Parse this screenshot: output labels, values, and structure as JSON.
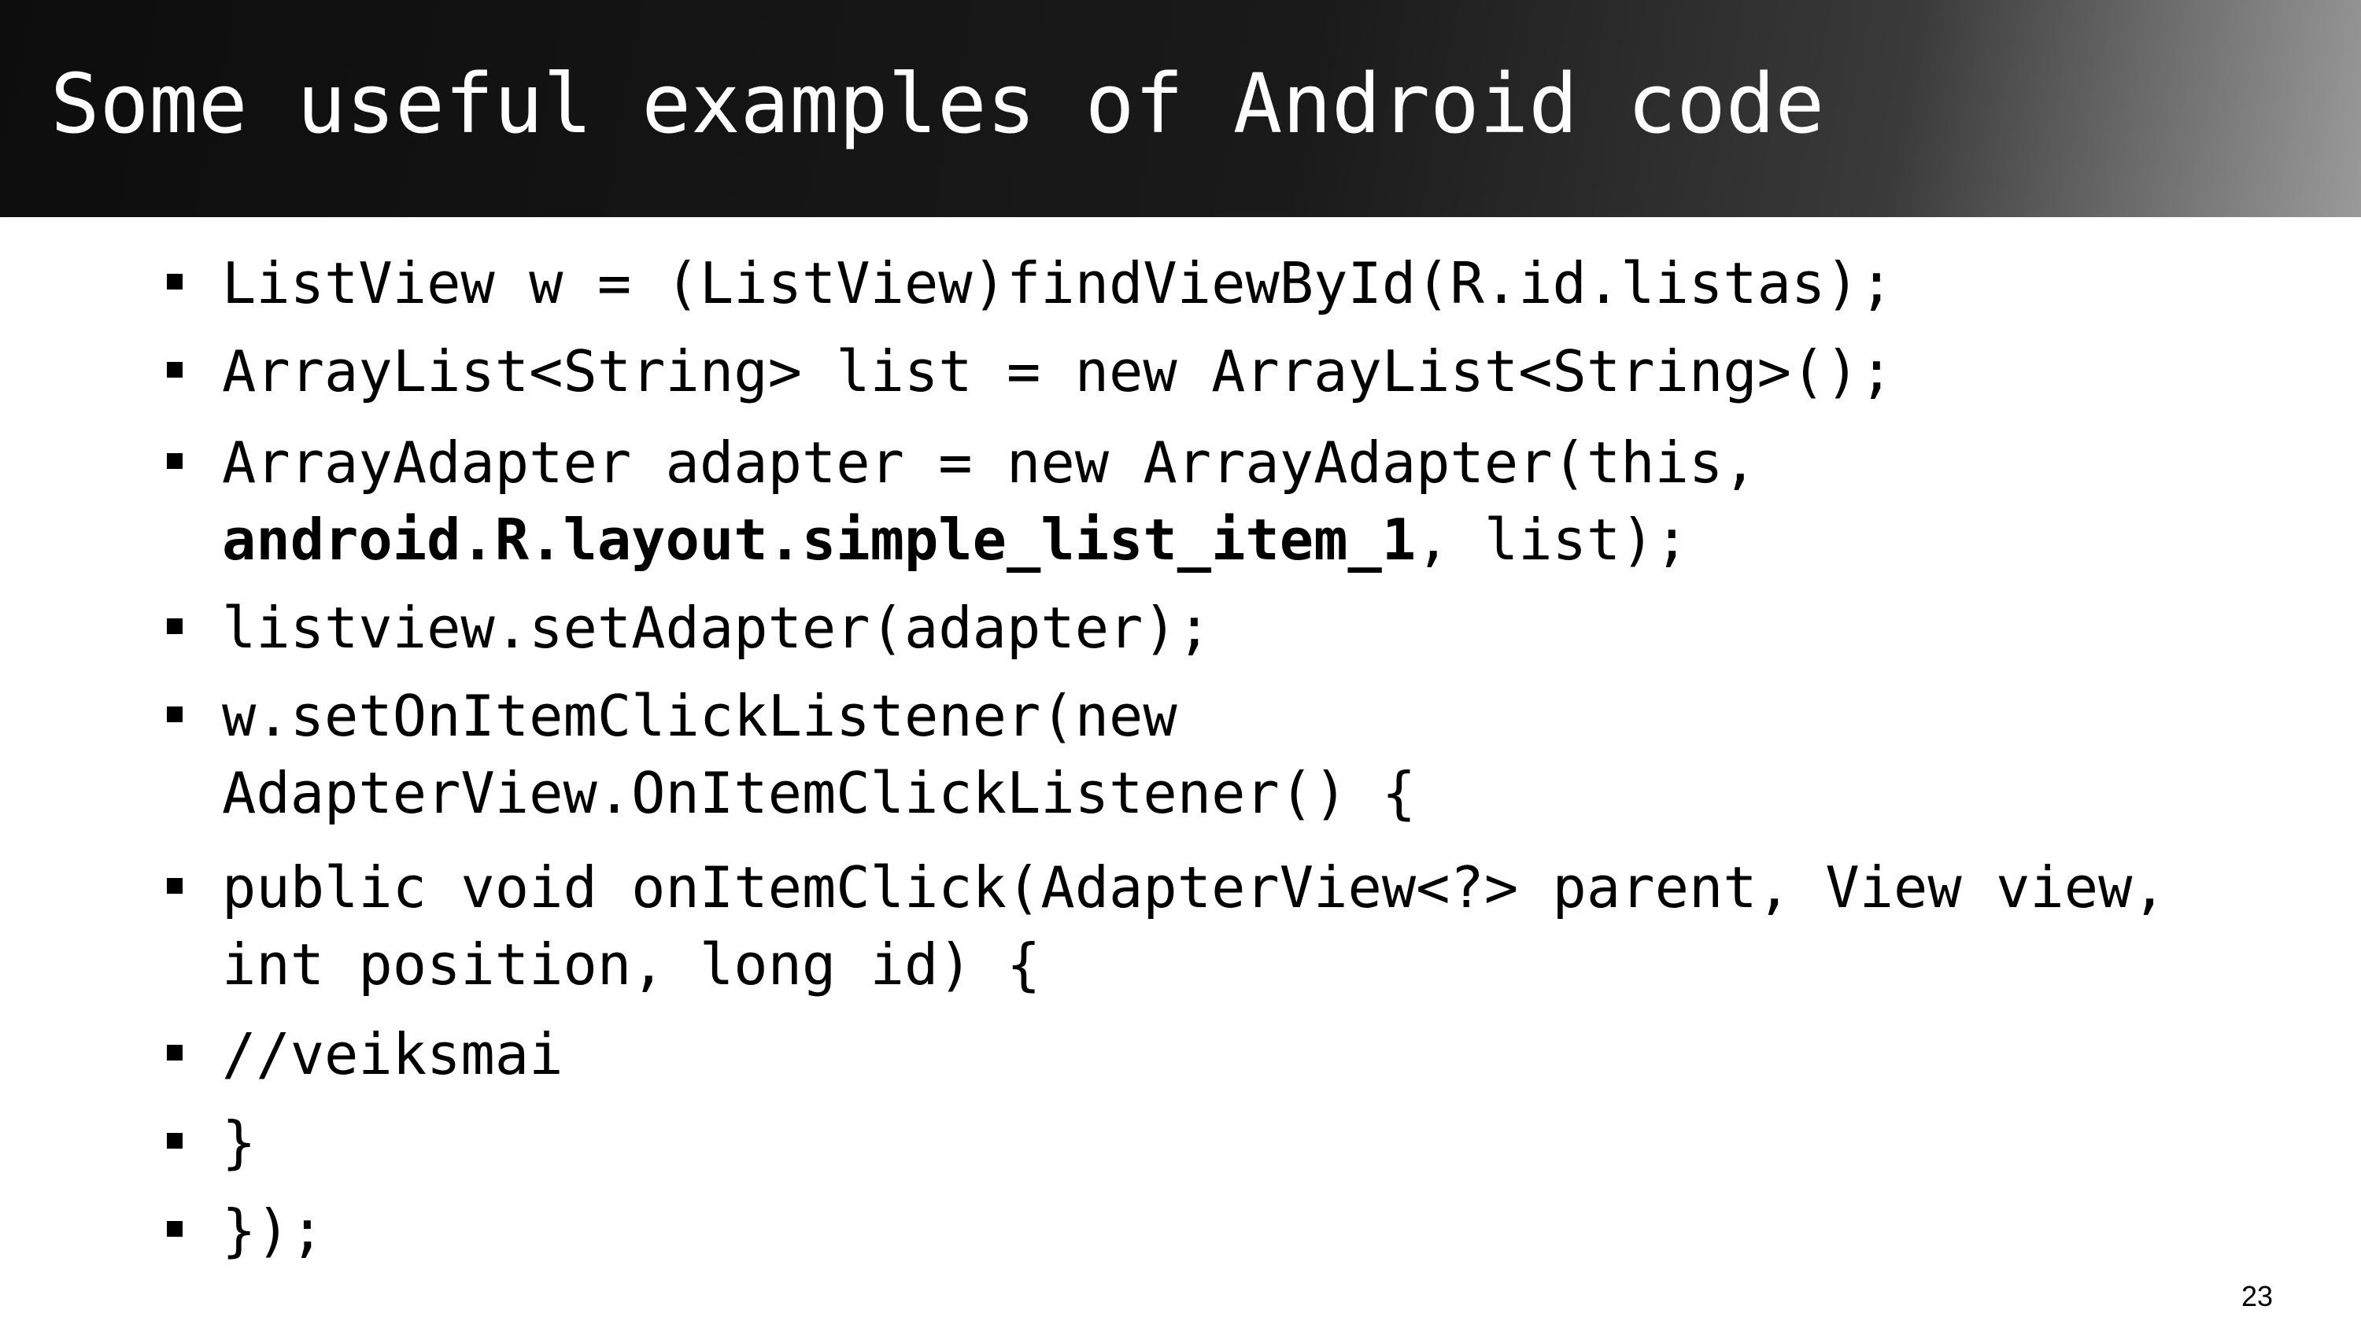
{
  "slide": {
    "title": "Some useful examples of Android code",
    "page_number": "23",
    "bullets": [
      {
        "lines": [
          "ListView w = (ListView)findViewById(R.id.listas);"
        ]
      },
      {
        "lines": [
          "ArrayList<String> list = new ArrayList<String>();"
        ]
      },
      {
        "line1": "ArrayAdapter adapter = new ArrayAdapter(this,",
        "line2_bold": "android.R.layout.simple_list_item_1",
        "line2_rest": ", list);"
      },
      {
        "lines": [
          "listview.setAdapter(adapter);"
        ]
      },
      {
        "lines": [
          "w.setOnItemClickListener(new",
          "AdapterView.OnItemClickListener() {"
        ]
      },
      {
        "lines": [
          "public void onItemClick(AdapterView<?> parent, View view,",
          "int position, long id) {"
        ]
      },
      {
        "lines": [
          "//veiksmai"
        ]
      },
      {
        "lines": [
          "}"
        ]
      },
      {
        "lines": [
          "});"
        ]
      }
    ]
  }
}
